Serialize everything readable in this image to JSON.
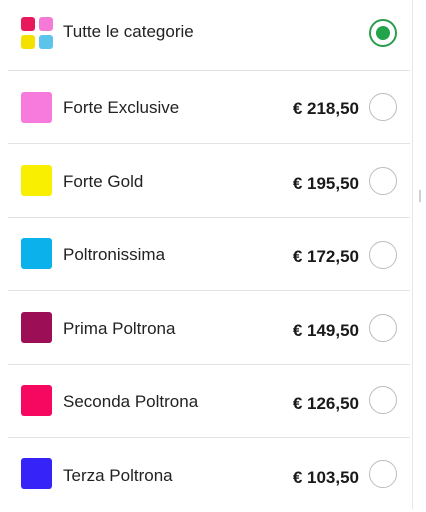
{
  "all_categories": {
    "label": "Tutte le categorie",
    "selected": true,
    "icon_colors": [
      "#e8185d",
      "#f57ad6",
      "#f5e100",
      "#5cc3ea"
    ]
  },
  "categories": [
    {
      "label": "Forte Exclusive",
      "price": "€ 218,50",
      "color": "#f77bdc",
      "selected": false
    },
    {
      "label": "Forte Gold",
      "price": "€ 195,50",
      "color": "#f9ef00",
      "selected": false
    },
    {
      "label": "Poltronissima",
      "price": "€ 172,50",
      "color": "#0bb1ea",
      "selected": false
    },
    {
      "label": "Prima Poltrona",
      "price": "€ 149,50",
      "color": "#9c0f56",
      "selected": false
    },
    {
      "label": "Seconda Poltrona",
      "price": "€ 126,50",
      "color": "#f60860",
      "selected": false
    },
    {
      "label": "Terza Poltrona",
      "price": "€ 103,50",
      "color": "#3523f8",
      "selected": false
    }
  ],
  "colors": {
    "radio_selected": "#23a34b",
    "radio_border": "#bdbdbd",
    "divider": "#e3e3e3"
  }
}
